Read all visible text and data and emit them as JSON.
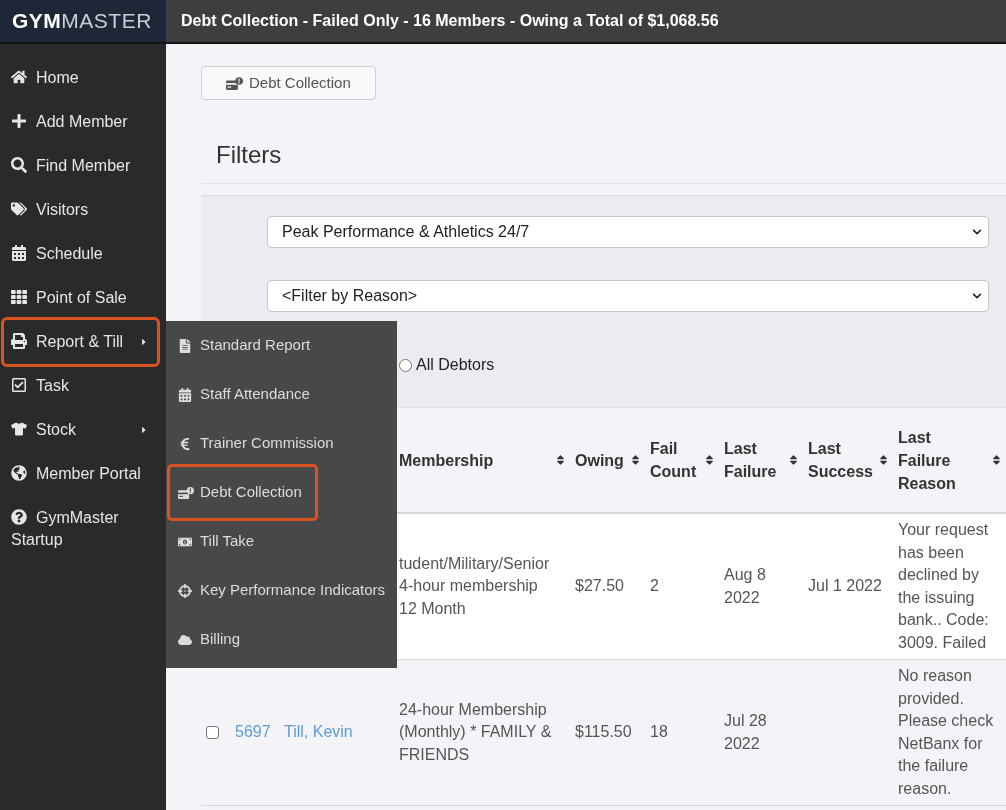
{
  "logo": {
    "text": "**GYM**MASTER"
  },
  "title_bar": {
    "title": "Debt Collection - Failed Only - 16 Members - Owing a Total of $1,068.56"
  },
  "sidebar": {
    "items": [
      {
        "label": "Home",
        "highlighted": false,
        "has_submenu": false
      },
      {
        "label": "Add Member",
        "highlighted": false,
        "has_submenu": false
      },
      {
        "label": "Find Member",
        "highlighted": false,
        "has_submenu": false
      },
      {
        "label": "Visitors",
        "highlighted": false,
        "has_submenu": false
      },
      {
        "label": "Schedule",
        "highlighted": false,
        "has_submenu": false
      },
      {
        "label": "Point of Sale",
        "highlighted": false,
        "has_submenu": false
      },
      {
        "label": "Report & Till",
        "highlighted": true,
        "has_submenu": true
      },
      {
        "label": "Task",
        "highlighted": false,
        "has_submenu": false
      },
      {
        "label": "Stock",
        "highlighted": false,
        "has_submenu": true
      },
      {
        "label": "Member Portal",
        "highlighted": false,
        "has_submenu": false
      },
      {
        "label": "GymMaster Startup",
        "highlighted": false,
        "has_submenu": false
      }
    ]
  },
  "submenu": {
    "items": [
      {
        "label": "Standard Report",
        "highlighted": false
      },
      {
        "label": "Staff Attendance",
        "highlighted": false
      },
      {
        "label": "Trainer Commission",
        "highlighted": false
      },
      {
        "label": "Debt Collection",
        "highlighted": true
      },
      {
        "label": "Till Take",
        "highlighted": false
      },
      {
        "label": "Key Performance Indicators",
        "highlighted": false
      },
      {
        "label": "Billing",
        "highlighted": false
      }
    ]
  },
  "toolbar": {
    "button": "Debt Collection"
  },
  "filters": {
    "heading": "Filters",
    "location_select": {
      "value": "Peak Performance & Athletics 24/7"
    },
    "reason_select": {
      "value": "<Filter by Reason>"
    },
    "radio": {
      "label": "All Debtors",
      "selected": false
    }
  },
  "table": {
    "columns": [
      {
        "label": "Membership"
      },
      {
        "label": "Owing"
      },
      {
        "label": "Fail Count"
      },
      {
        "label": "Last Failure"
      },
      {
        "label": "Last Success"
      },
      {
        "label": "Last Failure Reason"
      }
    ],
    "rows": [
      {
        "membership": "tudent/Military/Senior 4-hour membership 12 Month",
        "owing": "$27.50",
        "fail_count": "2",
        "last_failure": "Aug 8 2022",
        "last_success": "Jul 1 2022",
        "last_failure_reason": "Your request has been declined by the issuing bank.. Code: 3009. Failed"
      },
      {
        "checked": false,
        "id": "5697",
        "name": "Till, Kevin",
        "membership": "24-hour Membership (Monthly) * FAMILY & FRIENDS",
        "owing": "$115.50",
        "fail_count": "18",
        "last_failure": "Jul 28 2022",
        "last_failure_reason": "No reason provided. Please check NetBanx for the failure reason."
      }
    ]
  }
}
